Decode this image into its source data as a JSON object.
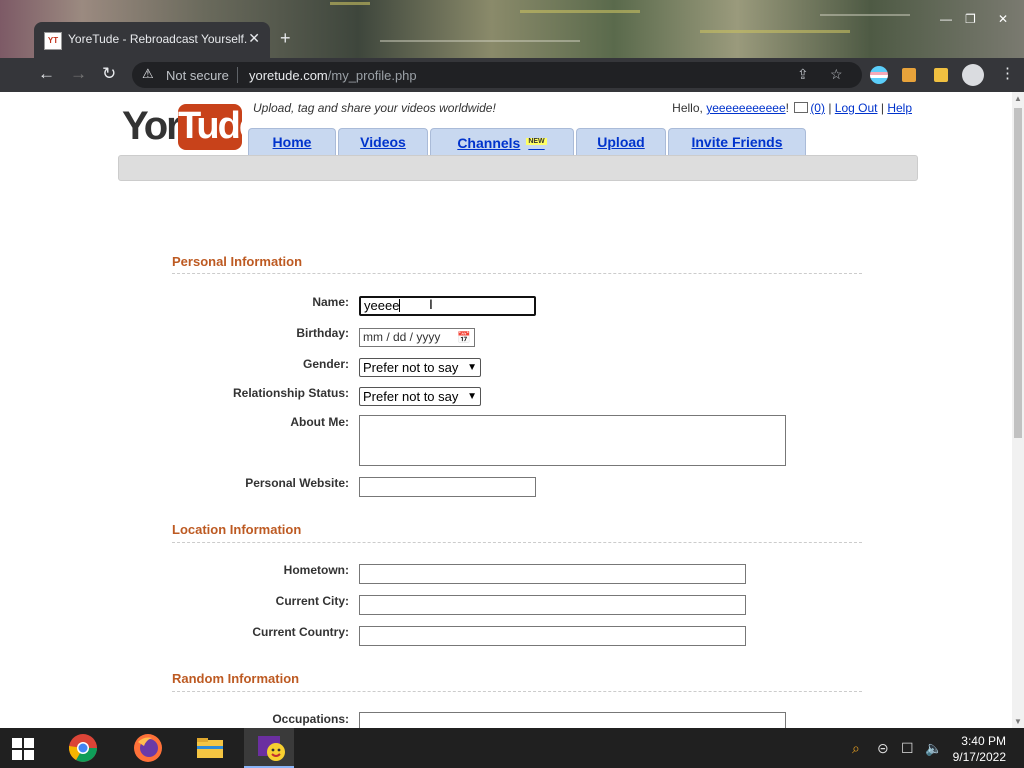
{
  "browser": {
    "tab_title": "YoreTude - Rebroadcast Yourself.",
    "tab_close": "✕",
    "new_tab": "+",
    "not_secure": "Not secure",
    "url_host": "yoretude.com",
    "url_path": "/my_profile.php"
  },
  "header": {
    "logo_part1": "Yore",
    "logo_part2": "Tude",
    "tagline": "Upload, tag and share your videos worldwide!",
    "hello": "Hello,",
    "username": "yeeeeeeeeeee",
    "exclaim": "!",
    "mail_count": "(0)",
    "sep1": "|",
    "logout": "Log Out",
    "sep2": "|",
    "help": "Help"
  },
  "nav": {
    "home": "Home",
    "videos": "Videos",
    "channels": "Channels",
    "channels_badge": "NEW",
    "upload": "Upload",
    "invite": "Invite Friends"
  },
  "personal": {
    "title": "Personal Information",
    "name_label": "Name:",
    "name_value": "yeeee",
    "birthday_label": "Birthday:",
    "birthday_placeholder": "mm / dd / yyyy",
    "gender_label": "Gender:",
    "gender_value": "Prefer not to say",
    "relationship_label": "Relationship Status:",
    "relationship_value": "Prefer not to say",
    "about_label": "About Me:",
    "website_label": "Personal Website:"
  },
  "location": {
    "title": "Location Information",
    "hometown_label": "Hometown:",
    "city_label": "Current City:",
    "country_label": "Current Country:"
  },
  "random": {
    "title": "Random Information",
    "occupations_label": "Occupations:"
  },
  "taskbar": {
    "time": "3:40 PM",
    "date": "9/17/2022"
  },
  "colors": {
    "section_title": "#bd5a22",
    "link": "#0033cc",
    "tab_bg": "#c8d8f0"
  }
}
